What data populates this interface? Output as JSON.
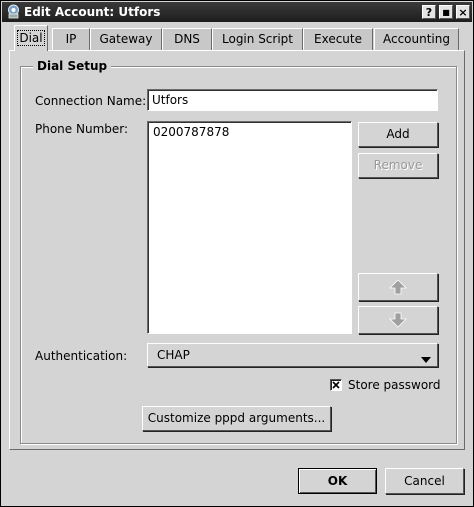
{
  "window": {
    "title": "Edit Account: Utfors",
    "help_label": "?",
    "maximize_label": "■",
    "close_label": "×"
  },
  "tabs": [
    {
      "label": "Dial"
    },
    {
      "label": "IP"
    },
    {
      "label": "Gateway"
    },
    {
      "label": "DNS"
    },
    {
      "label": "Login Script"
    },
    {
      "label": "Execute"
    },
    {
      "label": "Accounting"
    }
  ],
  "dial_setup": {
    "group_title": "Dial Setup",
    "connection_name_label": "Connection Name:",
    "connection_name_value": "Utfors",
    "phone_number_label": "Phone Number:",
    "phone_numbers": [
      "0200787878"
    ],
    "add_label": "Add",
    "remove_label": "Remove",
    "authentication_label": "Authentication:",
    "authentication_value": "CHAP",
    "store_password_label": "Store password",
    "store_password_checked": true,
    "customize_label": "Customize pppd arguments..."
  },
  "footer": {
    "ok_label": "OK",
    "cancel_label": "Cancel"
  },
  "icons": {
    "app": "kppp-icon",
    "move_up": "arrow-up-icon",
    "move_down": "arrow-down-icon",
    "dropdown": "chevron-down-icon"
  }
}
